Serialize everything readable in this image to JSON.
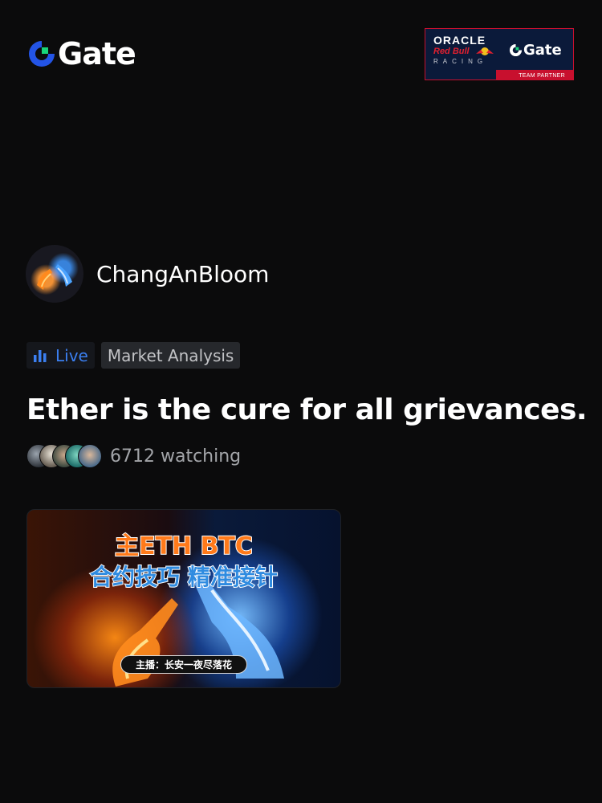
{
  "header": {
    "brand": "Gate",
    "brand_color": "#2354e6",
    "partner": {
      "line1": "ORACLE",
      "line2": "Red Bull",
      "line3": "RACING",
      "brand": "Gate",
      "footer": "TEAM PARTNER"
    }
  },
  "stream": {
    "streamer_name": "ChangAnBloom",
    "live_label": "Live",
    "category": "Market Analysis",
    "title": "Ether is the cure for all grievances.",
    "viewer_count_text": "6712 watching",
    "thumbnail": {
      "line1": "主ETH BTC",
      "line2": "合约技巧 精准接针",
      "host_label": "主播：长安一夜尽落花"
    }
  },
  "colors": {
    "background": "#0b0b0c",
    "live_accent": "#3b7ff0",
    "fire": "#ff7a1a",
    "ice": "#2f8be0"
  }
}
